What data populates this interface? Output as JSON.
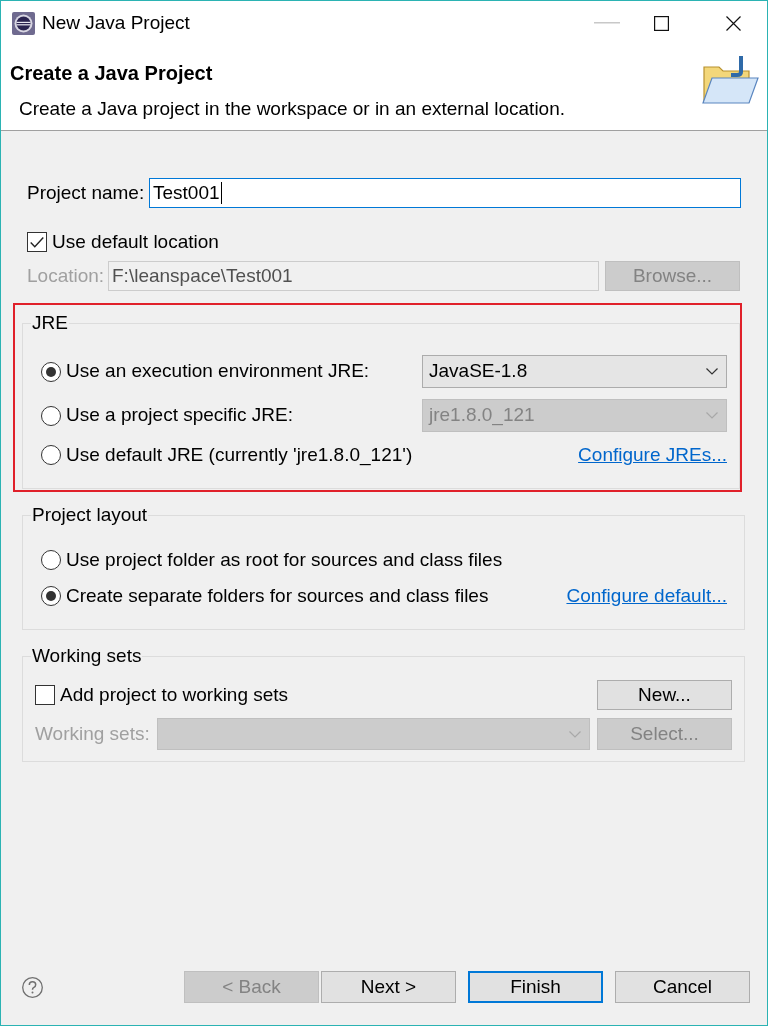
{
  "window": {
    "title": "New Java Project"
  },
  "header": {
    "title": "Create a Java Project",
    "description": "Create a Java project in the workspace or in an external location."
  },
  "project_name": {
    "label": "Project name:",
    "value": "Test001",
    "focused": true
  },
  "use_default_location": {
    "label": "Use default location",
    "checked": true
  },
  "location": {
    "label": "Location:",
    "value": "F:\\leanspace\\Test001",
    "disabled": true
  },
  "browse_button": {
    "label": "Browse...",
    "disabled": true
  },
  "jre_group": {
    "title": "JRE",
    "highlighted": true,
    "options": [
      {
        "label": "Use an execution environment JRE:",
        "selected": true,
        "dropdown": {
          "value": "JavaSE-1.8",
          "disabled": false
        }
      },
      {
        "label": "Use a project specific JRE:",
        "selected": false,
        "dropdown": {
          "value": "jre1.8.0_121",
          "disabled": true
        }
      },
      {
        "label": "Use default JRE (currently 'jre1.8.0_121')",
        "selected": false,
        "link": "Configure JREs..."
      }
    ]
  },
  "project_layout_group": {
    "title": "Project layout",
    "options": [
      {
        "label": "Use project folder as root for sources and class files",
        "selected": false
      },
      {
        "label": "Create separate folders for sources and class files",
        "selected": true,
        "link": "Configure default..."
      }
    ]
  },
  "working_sets_group": {
    "title": "Working sets",
    "add_to_working_sets": {
      "label": "Add project to working sets",
      "checked": false
    },
    "new_button": {
      "label": "New...",
      "disabled": false
    },
    "working_sets_field": {
      "label": "Working sets:",
      "disabled": true
    },
    "select_button": {
      "label": "Select...",
      "disabled": true
    }
  },
  "buttons": [
    {
      "label": "< Back",
      "disabled": true,
      "default": false
    },
    {
      "label": "Next >",
      "disabled": false,
      "default": false
    },
    {
      "label": "Finish",
      "disabled": false,
      "default": true
    },
    {
      "label": "Cancel",
      "disabled": false,
      "default": false
    }
  ]
}
